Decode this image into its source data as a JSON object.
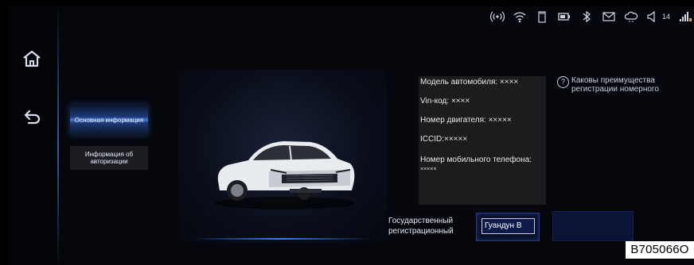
{
  "nav": {
    "home_icon": "home-icon",
    "back_icon": "back-arrow-icon"
  },
  "status_bar": {
    "icons": [
      "hotspot-icon",
      "wifi-icon",
      "sd-card-icon",
      "battery-icon",
      "bluetooth-icon",
      "mail-icon",
      "cloud-icon",
      "volume-icon",
      "signal-icon"
    ],
    "volume_level": "14"
  },
  "menu": {
    "items": [
      {
        "label": "Основная информация",
        "active": true
      },
      {
        "label": "Информация об авторизации",
        "active": false
      }
    ]
  },
  "vehicle_info": {
    "model": "Модель автомобиля: ××××",
    "vin": "Vin-код: ××××",
    "engine": "Номер двигателя: ×××××",
    "iccid": "ICCID:×××××",
    "phone_label": "Номер мобильного телефона:",
    "phone_value": "×××××"
  },
  "help": {
    "text": "Каковы преимущества регистрации номерного"
  },
  "plate": {
    "label": "Государственный регистрационный",
    "value": "Гуандун В",
    "second_value": ""
  },
  "figure_code": "B705066O",
  "colors": {
    "accent": "#3a7ff0",
    "background": "#05070c",
    "info_box": "#1c1c1e",
    "plate_field": "#0f1a4a"
  }
}
